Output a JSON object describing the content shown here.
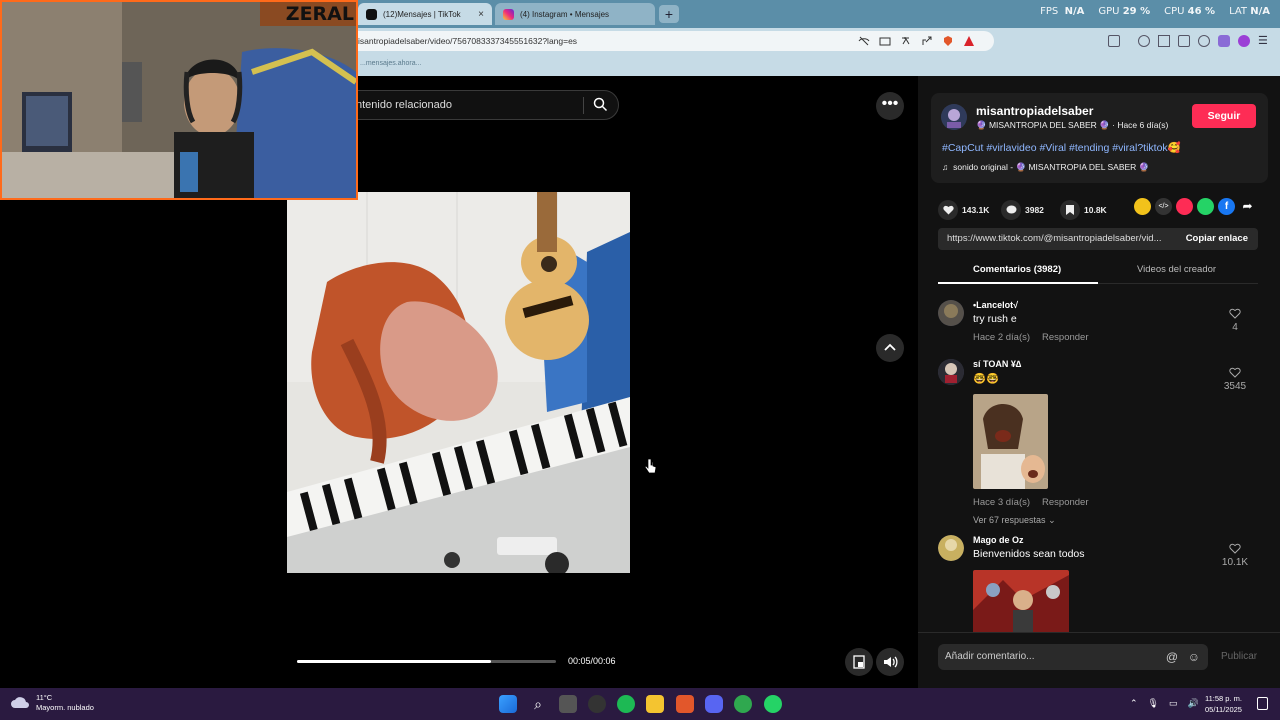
{
  "browser": {
    "tabs": [
      {
        "label": "(12)Mensajes | TikTok",
        "active": true
      },
      {
        "label": "(4) Instagram • Mensajes",
        "active": false
      }
    ],
    "new_tab": "+",
    "stats": {
      "fps_label": "FPS",
      "fps": "N/A",
      "gpu_label": "GPU",
      "gpu": "29 %",
      "cpu_label": "CPU",
      "cpu": "46 %",
      "lat_label": "LAT",
      "lat": "N/A"
    },
    "url": "isantropiadelsaber/video/7567083337345551632?lang=es",
    "bookmark": "...mensajes.ahora..."
  },
  "webcam": {
    "overlay_text": "ZERAL"
  },
  "video": {
    "search_placeholder": "ntenido relacionado",
    "progress": 0.75,
    "time": "00:05/00:06"
  },
  "post": {
    "username": "misantropiadelsaber",
    "display_name": "🔮 MISANTROPIA DEL SABER 🔮",
    "age": "· Hace 6 día(s)",
    "follow_label": "Seguir",
    "hashtags": "#CapCut #virlavideo #Viral #tending #viral?tiktok",
    "hashtag_emoji": "🥰",
    "sound_prefix": "sonido original -",
    "sound_author": "🔮 MISANTROPIA DEL SABER 🔮",
    "likes": "143.1K",
    "comments_count": "3982",
    "saves": "10.8K",
    "link": "https://www.tiktok.com/@misantropiadelsaber/vid...",
    "copy_label": "Copiar enlace",
    "tab_comments": "Comentarios (3982)",
    "tab_creator": "Videos del creador"
  },
  "comments": [
    {
      "name": "•Lancelot√",
      "text": "try rush e",
      "meta": "Hace 2 día(s)",
      "reply": "Responder",
      "likes": "4"
    },
    {
      "name": "sí TOAN ¥∆",
      "text": "🤓🤓",
      "meta": "Hace 3 día(s)",
      "reply": "Responder",
      "likes": "3545",
      "replies": "Ver 67 respuestas"
    },
    {
      "name": "Mago de Oz",
      "text": "Bienvenidos sean todos",
      "likes": "10.1K"
    }
  ],
  "composer": {
    "placeholder": "Añadir comentario...",
    "publish": "Publicar"
  },
  "taskbar": {
    "temp": "11°C",
    "weather": "Mayorm. nublado",
    "time": "11:58 p. m.",
    "date": "05/11/2025"
  },
  "colors": {
    "accent": "#fe2c55",
    "hashtag": "#8fb7ff",
    "chrome": "#c6dbe6"
  }
}
